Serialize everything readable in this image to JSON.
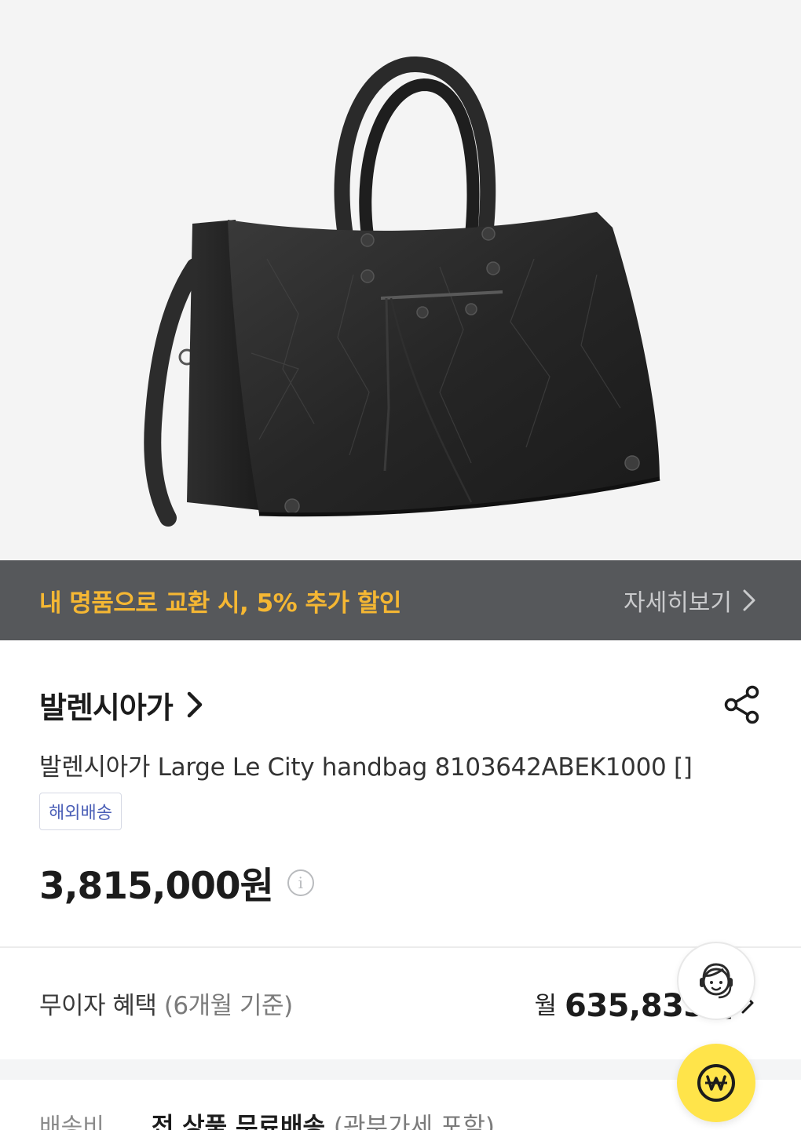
{
  "hero": {
    "alt": "black leather large city handbag"
  },
  "promo": {
    "text": "내 명품으로 교환 시, 5% 추가 할인",
    "link_label": "자세히보기"
  },
  "brand": {
    "name": "발렌시아가"
  },
  "product": {
    "title": "발렌시아가 Large Le City handbag 8103642ABEK1000 []",
    "shipping_badge": "해외배송",
    "price": "3,815,000원"
  },
  "installment": {
    "label": "무이자 혜택",
    "period": "(6개월 기준)",
    "prefix": "월",
    "amount": "635,833원"
  },
  "shipping": {
    "label": "배송비",
    "value": "전 상품 무료배송",
    "note": "(관부가세 포함)"
  },
  "icons": {
    "info": "info-icon",
    "share": "share-icon",
    "chevron": "chevron-right-icon",
    "customer_service": "headset-agent-icon",
    "wallet": "won-coin-icon"
  },
  "colors": {
    "promo_bg": "#56585b",
    "promo_text": "#f5b733",
    "badge_text": "#4b5fb7",
    "wallet_button": "#ffe44a"
  }
}
